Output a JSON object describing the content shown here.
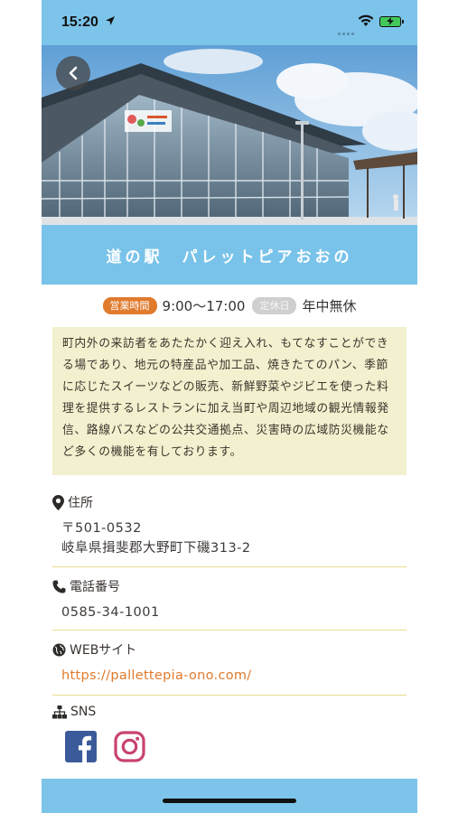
{
  "status_bar": {
    "time": "15:20",
    "battery_charging": true
  },
  "header": {
    "title": "道の駅　パレットピアおおの"
  },
  "hours": {
    "badge_label": "営業時間",
    "value": "9:00～17:00",
    "closed_badge_label": "定休日",
    "closed_value": "年中無休"
  },
  "description": "町内外の来訪者をあたたかく迎え入れ、もてなすことができる場であり、地元の特産品や加工品、焼きたてのパン、季節に応じたスイーツなどの販売、新鮮野菜やジビエを使った料理を提供するレストランに加え当町や周辺地域の観光情報発信、路線バスなどの公共交通拠点、災害時の広域防災機能など多くの機能を有しております。",
  "address": {
    "label": "住所",
    "postal": "〒501-0532",
    "line": "岐阜県揖斐郡大野町下磯313-2"
  },
  "phone": {
    "label": "電話番号",
    "number": "0585-34-1001"
  },
  "website": {
    "label": "WEBサイト",
    "url": "https://pallettepia-ono.com/"
  },
  "sns": {
    "label": "SNS",
    "icons": [
      "facebook-icon",
      "instagram-icon"
    ]
  },
  "colors": {
    "accent_blue": "#79c3ea",
    "accent_orange": "#e07a2c",
    "description_bg": "#f3f0cf",
    "separator": "#e9dc8f"
  }
}
